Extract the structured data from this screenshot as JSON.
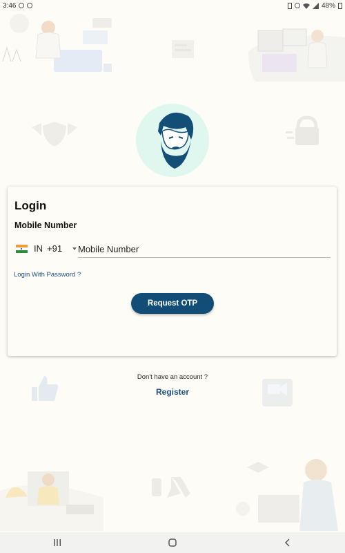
{
  "status_bar": {
    "time": "3:46",
    "battery": "48%"
  },
  "login": {
    "title": "Login",
    "mobile_label": "Mobile Number",
    "country_code": "IN",
    "dial_code": "+91",
    "mobile_placeholder": "Mobile Number",
    "login_with_password": "Login With Password ?",
    "request_otp": "Request OTP"
  },
  "footer": {
    "no_account": "Don't have an account ?",
    "register": "Register"
  },
  "colors": {
    "background": "#fdfcf6",
    "primary_button": "#124d78",
    "link": "#1c4e84",
    "avatar_bg": "#dff7ef"
  },
  "icons": [
    "whatsapp-icon",
    "wifi-icon",
    "battery-icon",
    "india-flag-icon",
    "recents-icon",
    "home-icon",
    "back-icon"
  ]
}
